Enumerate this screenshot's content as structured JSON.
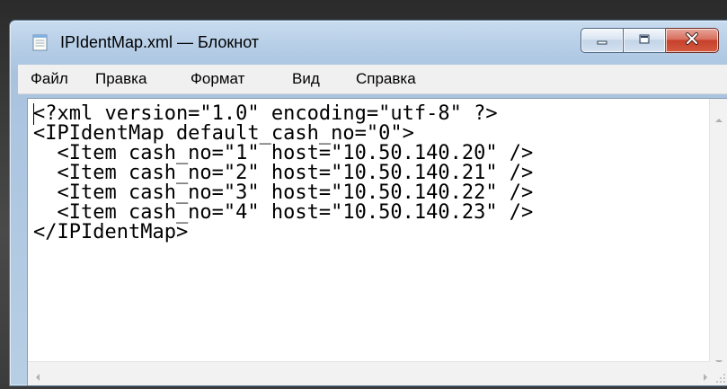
{
  "window": {
    "title": "IPIdentMap.xml — Блокнот"
  },
  "menu": {
    "items": [
      "Файл",
      "Правка",
      "Формат",
      "Вид",
      "Справка"
    ]
  },
  "editor": {
    "lines": [
      "<?xml version=\"1.0\" encoding=\"utf-8\" ?>",
      "<IPIdentMap default_cash_no=\"0\">",
      "  <Item cash_no=\"1\" host=\"10.50.140.20\" />",
      "  <Item cash_no=\"2\" host=\"10.50.140.21\" />",
      "  <Item cash_no=\"3\" host=\"10.50.140.22\" />",
      "  <Item cash_no=\"4\" host=\"10.50.140.23\" />",
      "</IPIdentMap>"
    ]
  },
  "icons": {
    "app": "notepad-icon",
    "minimize": "minimize-icon",
    "maximize": "maximize-icon",
    "close": "close-icon",
    "scroll_up": "arrow-up-icon",
    "scroll_down": "arrow-down-icon",
    "scroll_left": "arrow-left-icon",
    "scroll_right": "arrow-right-icon",
    "resize": "resize-grip-icon"
  }
}
